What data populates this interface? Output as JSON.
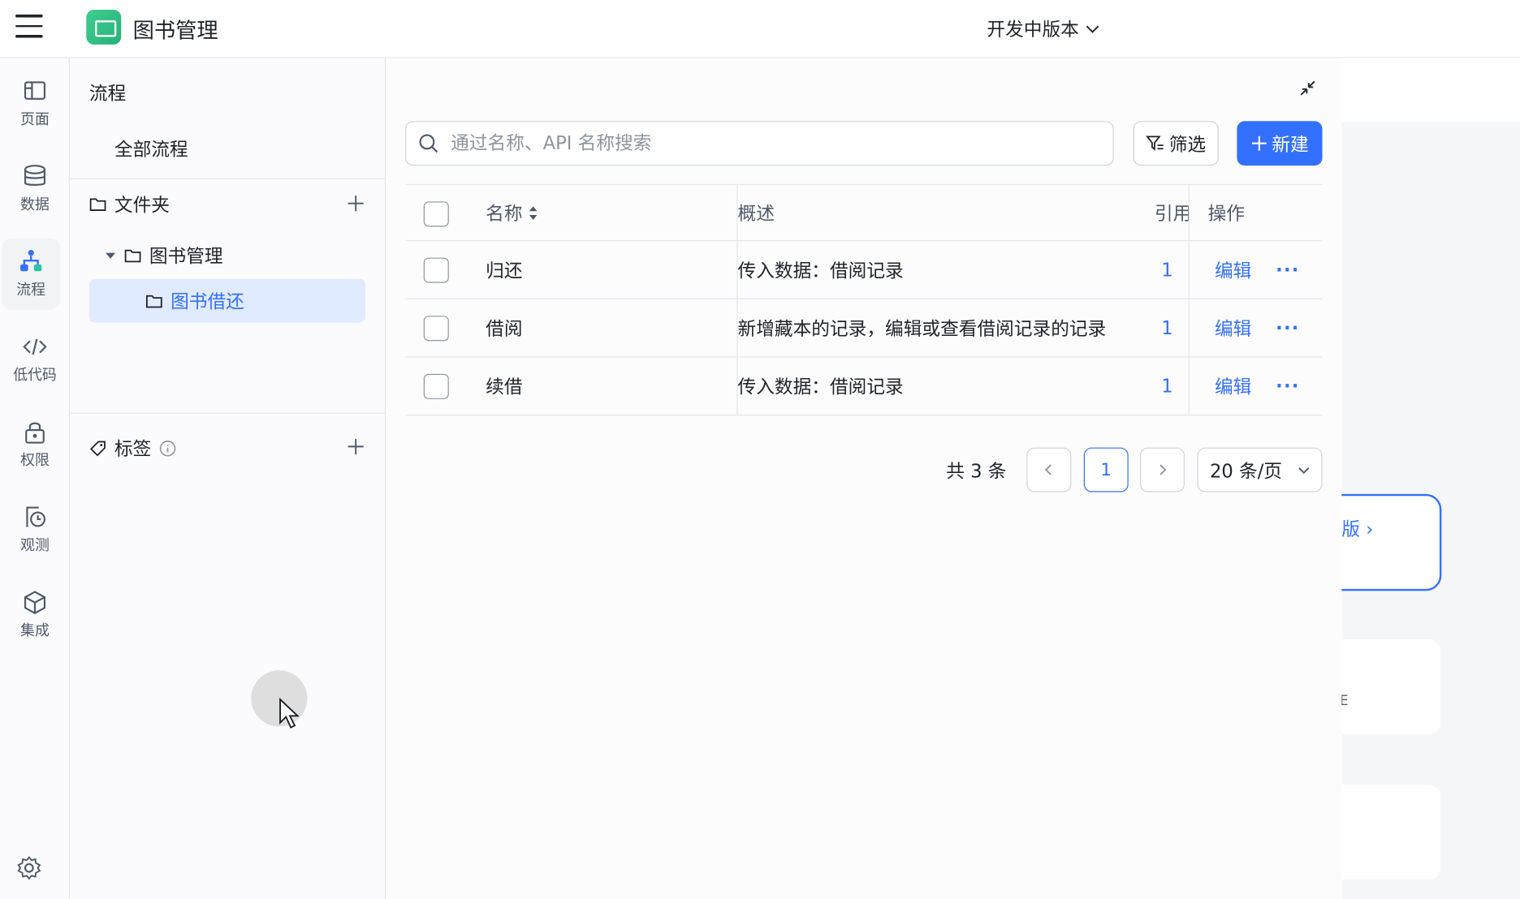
{
  "app": {
    "title": "图书管理",
    "version": "开发中版本"
  },
  "rail": [
    {
      "label": "页面",
      "icon": "layout-icon"
    },
    {
      "label": "数据",
      "icon": "database-icon"
    },
    {
      "label": "流程",
      "icon": "flow-icon",
      "active": true
    },
    {
      "label": "低代码",
      "icon": "code-icon"
    },
    {
      "label": "权限",
      "icon": "lock-icon"
    },
    {
      "label": "观测",
      "icon": "monitor-icon"
    },
    {
      "label": "集成",
      "icon": "cube-icon"
    }
  ],
  "panel": {
    "title": "流程",
    "all": "全部流程",
    "folder_section": "文件夹",
    "folder_root": "图书管理",
    "folder_selected": "图书借还",
    "tags_section": "标签"
  },
  "search": {
    "placeholder": "通过名称、API 名称搜索",
    "value": ""
  },
  "toolbar": {
    "filter_label": "筛选",
    "new_label": "新建"
  },
  "table": {
    "columns": {
      "name": "名称",
      "desc": "概述",
      "ref": "引用",
      "op": "操作"
    },
    "rows": [
      {
        "name": "归还",
        "desc": "传入数据：借阅记录",
        "ref": "1",
        "edit": "编辑",
        "more": "···"
      },
      {
        "name": "借阅",
        "desc": "新增藏本的记录，编辑或查看借阅记录的记录",
        "ref": "1",
        "edit": "编辑",
        "more": "···"
      },
      {
        "name": "续借",
        "desc": "传入数据：借阅记录",
        "ref": "1",
        "edit": "编辑",
        "more": "···"
      }
    ]
  },
  "pagination": {
    "total": "共 3 条",
    "current": "1",
    "page_size": "20 条/页"
  },
  "background": {
    "card_text": "版",
    "card2_text": "E"
  },
  "colors": {
    "accent": "#3370ff",
    "selected_bg": "#e1ebff",
    "border": "#e5e6eb"
  }
}
